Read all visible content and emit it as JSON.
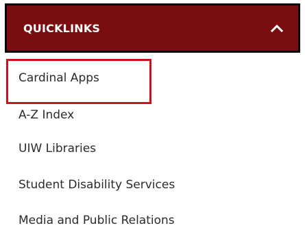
{
  "quicklinks": {
    "title": "QUICKLINKS",
    "toggle_icon": "chevron-up-icon",
    "header_color": "#7a0d10",
    "highlight_color": "#cc1119",
    "links": [
      {
        "label": "Cardinal Apps"
      },
      {
        "label": "A-Z Index"
      },
      {
        "label": "UIW Libraries"
      },
      {
        "label": "Student Disability Services"
      },
      {
        "label": "Media and Public Relations"
      }
    ]
  }
}
